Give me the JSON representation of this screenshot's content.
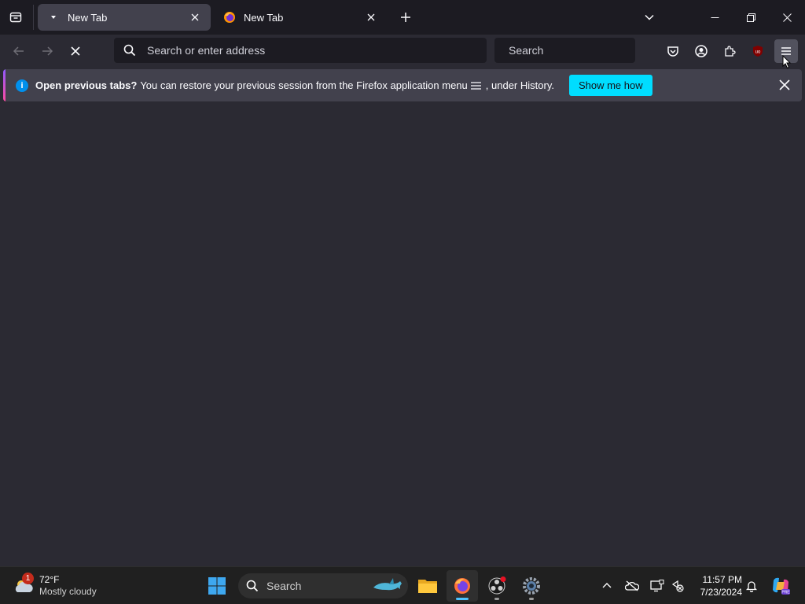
{
  "browser": {
    "tabs": [
      {
        "title": "New Tab",
        "active": true
      },
      {
        "title": "New Tab",
        "active": false
      }
    ],
    "urlbar": {
      "placeholder": "Search or enter address"
    },
    "searchbar": {
      "placeholder": "Search"
    },
    "toolbar_buttons": [
      "pocket-icon",
      "account-icon",
      "extensions-icon",
      "ublock-icon",
      "hamburger-menu-icon"
    ],
    "accent_color": "#00ddff"
  },
  "notification": {
    "bold": "Open previous tabs?",
    "text_before_icon": "You can restore your previous session from the Firefox application menu",
    "text_after_icon": ", under History.",
    "button_label": "Show me how",
    "info_glyph": "i"
  },
  "taskbar": {
    "weather": {
      "temperature": "72°F",
      "condition": "Mostly cloudy",
      "badge": "1"
    },
    "search_label": "Search",
    "apps": [
      "windows-start-icon",
      "file-explorer-icon",
      "firefox-icon",
      "obs-icon",
      "settings-icon"
    ],
    "clock": {
      "time": "11:57 PM",
      "date": "7/23/2024"
    }
  }
}
